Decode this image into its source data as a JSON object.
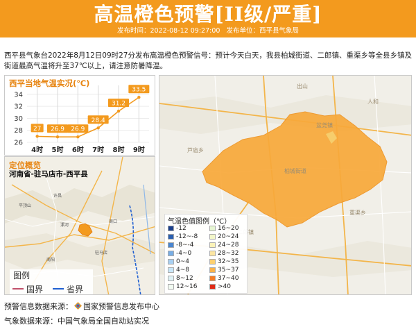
{
  "header": {
    "title": "高温橙色预警[II级/严重]",
    "time_label": "发布时间：2022-08-12 09:27:00",
    "unit_label": "发布单位：西平县气象局"
  },
  "description": "西平县气象台2022年8月12日09时27分发布高温橙色预警信号：预计今天白天，我县柏城街道、二郎镇、重渠乡等全县乡镇及街道最高气温将升至37℃以上，请注意防暑降温。",
  "temperature_panel": {
    "title": "西平当地气温实况(℃)"
  },
  "chart_data": {
    "type": "line",
    "title": "西平当地气温实况(℃)",
    "categories": [
      "4时",
      "5时",
      "6时",
      "7时",
      "8时",
      "9时"
    ],
    "series": [
      {
        "values": [
          27,
          26.9,
          26.9,
          28.4,
          31.2,
          33.5
        ]
      }
    ],
    "data_labels": [
      "27",
      "26.9",
      "26.9",
      "28.4",
      "31.2",
      "33.5"
    ],
    "y_ticks": [
      "26",
      "28",
      "30",
      "32",
      "34"
    ],
    "ylim": [
      26,
      34.8
    ],
    "grid": true,
    "line_color": "#f39a1e",
    "label_bg_color": "#f39a1e"
  },
  "location_panel": {
    "title": "定位概览",
    "location": "河南省-驻马店市-西平县",
    "legend_title": "图例",
    "legend_items": [
      {
        "label": "国界",
        "color": "#c0506a"
      },
      {
        "label": "省界",
        "color": "#1f5fd1"
      }
    ]
  },
  "map_legend": {
    "title": "气温色值图例（℃）",
    "items": [
      {
        "label": "-12",
        "color": "#1a3f8c"
      },
      {
        "label": "-12~-8",
        "color": "#2a5fb0"
      },
      {
        "label": "-8~-4",
        "color": "#4a86d0"
      },
      {
        "label": "-4~0",
        "color": "#78aee6"
      },
      {
        "label": "0~4",
        "color": "#a8d0f2"
      },
      {
        "label": "4~8",
        "color": "#c8e6f8"
      },
      {
        "label": "8~12",
        "color": "#dff2f6"
      },
      {
        "label": "12~16",
        "color": "#f2fbf2"
      },
      {
        "label": "16~20",
        "color": "#e6f6d2"
      },
      {
        "label": "20~24",
        "color": "#f3f7c9"
      },
      {
        "label": "24~28",
        "color": "#fbf2b7"
      },
      {
        "label": "28~32",
        "color": "#fde6a2"
      },
      {
        "label": "32~35",
        "color": "#fcd071"
      },
      {
        "label": "35~37",
        "color": "#f9b24a"
      },
      {
        "label": "37~40",
        "color": "#f57c24"
      },
      {
        "label": ">40",
        "color": "#e02a16"
      }
    ]
  },
  "footer": {
    "warning_source_label": "预警信息数据来源：",
    "warning_source_name": "国家预警信息发布中心",
    "weather_source": "气象数据来源：中国气象局全国自动站实况"
  },
  "colors": {
    "accent": "#f39a1e",
    "title_orange": "#e78410",
    "region_fill": "#f8a93a"
  }
}
